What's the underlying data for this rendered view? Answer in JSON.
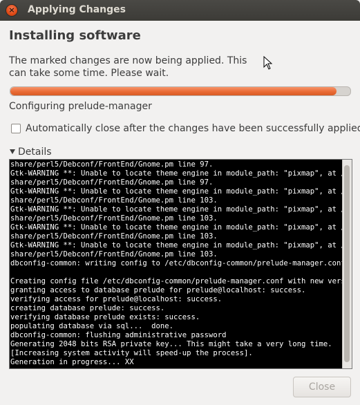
{
  "window": {
    "title": "Applying Changes"
  },
  "main": {
    "heading": "Installing software",
    "description": "The marked changes are now being applied. This can take some time. Please wait.",
    "progress": 0.96,
    "status": "Configuring prelude-manager",
    "auto_close_label": "Automatically close after the changes have been successfully applied",
    "auto_close_checked": false,
    "details_label": "Details"
  },
  "terminal": {
    "lines": [
      "share/perl5/Debconf/FrontEnd/Gnome.pm line 97.",
      "Gtk-WARNING **: Unable to locate theme engine in module_path: \"pixmap\", at /usr/",
      "share/perl5/Debconf/FrontEnd/Gnome.pm line 97.",
      "Gtk-WARNING **: Unable to locate theme engine in module_path: \"pixmap\", at /usr/",
      "share/perl5/Debconf/FrontEnd/Gnome.pm line 103.",
      "Gtk-WARNING **: Unable to locate theme engine in module_path: \"pixmap\", at /usr/",
      "share/perl5/Debconf/FrontEnd/Gnome.pm line 103.",
      "Gtk-WARNING **: Unable to locate theme engine in module_path: \"pixmap\", at /usr/",
      "share/perl5/Debconf/FrontEnd/Gnome.pm line 103.",
      "Gtk-WARNING **: Unable to locate theme engine in module_path: \"pixmap\", at /usr/",
      "share/perl5/Debconf/FrontEnd/Gnome.pm line 103.",
      "dbconfig-common: writing config to /etc/dbconfig-common/prelude-manager.conf",
      "",
      "Creating config file /etc/dbconfig-common/prelude-manager.conf with new version",
      "granting access to database prelude for prelude@localhost: success.",
      "verifying access for prelude@localhost: success.",
      "creating database prelude: success.",
      "verifying database prelude exists: success.",
      "populating database via sql...  done.",
      "dbconfig-common: flushing administrative password",
      "Generating 2048 bits RSA private key... This might take a very long time.",
      "[Increasing system activity will speed-up the process].",
      "Generation in progress... XX"
    ]
  },
  "footer": {
    "close_label": "Close"
  },
  "colors": {
    "accent": "#ea6b35",
    "titlebar": "#3c3b37",
    "terminal_bg": "#000000"
  }
}
